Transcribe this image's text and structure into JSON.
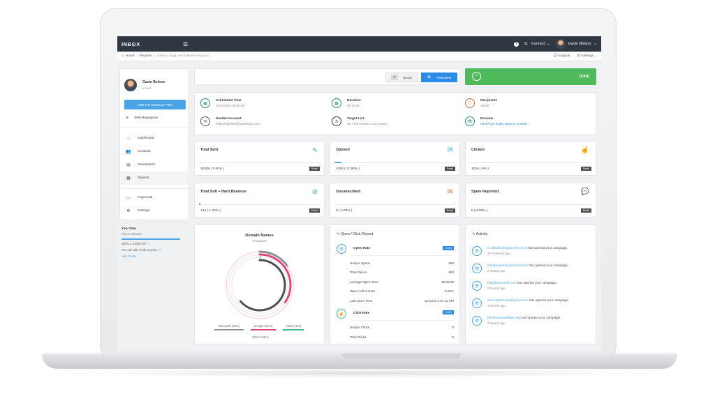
{
  "app": {
    "logo": "INB⊙X",
    "menu_icon": "hamburger-icon"
  },
  "topbar": {
    "help_icon": "question-icon",
    "connect_label": "Connect",
    "user_name": "Gavin Belson"
  },
  "breadcrumb": {
    "home": "Home",
    "reports": "Reports",
    "current": "Atalmız Saygı ve Özlemle Anıyoruz..."
  },
  "toolbar_right": {
    "support": "Support",
    "settings": "Settings"
  },
  "sidebar": {
    "user_name": "Gavin Belson",
    "location": "Hooli",
    "create_button": "CREATE NEWSLETTER",
    "reputation": "%89 Reputation",
    "items": [
      {
        "label": "Dashboard",
        "icon": "⌂"
      },
      {
        "label": "Contacts",
        "icon": "👥"
      },
      {
        "label": "Newsletters",
        "icon": "▤"
      },
      {
        "label": "Reports",
        "icon": "▦"
      },
      {
        "label": "Payments",
        "icon": "▭"
      },
      {
        "label": "Settings",
        "icon": "⚙"
      }
    ],
    "plan_title": "Your Plan",
    "plan_name": "Pay As You Go",
    "credits_left": "489711 credits left",
    "add_credit_note": "You can add credit anytime",
    "add_credit_link": "Add Credit"
  },
  "actions": {
    "back": "BACK",
    "preview": "PREVIEW",
    "done": "DONE"
  },
  "info": {
    "scheduled_label": "Scheduled Time",
    "scheduled_value": "11/10/2019 00:30:00",
    "duration_label": "Duration",
    "duration_value": "00:12:29",
    "recipients_label": "Recipients",
    "recipients_value": "10289",
    "sender_label": "Sender Account",
    "sender_value": "INBOX (destek@useinbox.com)",
    "target_label": "Target List",
    "target_value": "My First Contact List (10250)",
    "preview_label": "Preview",
    "preview_value": "Pied Piper finally slays its Goliath..."
  },
  "stats": [
    {
      "title": "Total Sent",
      "value": "10289 ( 0.00% )",
      "progress": 0
    },
    {
      "title": "Opened",
      "value": "1089 ( 17.86% )",
      "progress": 0.0586
    },
    {
      "title": "Clicked",
      "value": "1029 ( 9% )",
      "progress": 0
    },
    {
      "title": "Total Soft + Hard Bounces",
      "value": "144 ( 1.40% )",
      "progress": 0.014
    },
    {
      "title": "Unsubscribed",
      "value": "0 ( 0.00% )",
      "progress": 0
    },
    {
      "title": "Spam Reported",
      "value": "0 ( 0.00% )",
      "progress": 0
    }
  ],
  "detail_label": "Detail",
  "domains": {
    "title": "Domain Names",
    "subtitle": "Recipients",
    "legend": [
      {
        "label": "Microsoft (14%)",
        "color": "#8c9197"
      },
      {
        "label": "Google (31%)",
        "color": "#e0457b"
      },
      {
        "label": "Yahoo (1%)",
        "color": "#3fb68e"
      },
      {
        "label": "Other (54%)",
        "color": "#555"
      }
    ]
  },
  "report": {
    "title": "Open / Click Report",
    "open_rate_label": "Open Rate",
    "open_rate_badge": "5.86%",
    "rows": [
      {
        "label": "Unique Opens",
        "value": "603"
      },
      {
        "label": "Total Opens",
        "value": "853"
      },
      {
        "label": "Average Open Time",
        "value": "00:33:06"
      },
      {
        "label": "Open / Click Rate",
        "value": "0.00%"
      },
      {
        "label": "Last Open Time",
        "value": "11/13/19 1:07:22 PM"
      }
    ],
    "click_rate_label": "Click Rate",
    "click_rate_badge": "0.00%",
    "click_rows": [
      {
        "label": "Unique Clicks",
        "value": "0"
      },
      {
        "label": "Total Clicks",
        "value": "0"
      }
    ]
  },
  "activity": {
    "title": "Activity",
    "items": [
      {
        "email": "m.dikicifer@hyperroll.com.tr",
        "action": "has opened your campaign.",
        "time": "33 minute(s) ago"
      },
      {
        "email": "info@impanetworkshop.com",
        "action": "has opened your campaign.",
        "time": "2 hour(s) ago"
      },
      {
        "email": "bilgi@usemsoft.com",
        "action": "has opened your campaign.",
        "time": "3 hour(s) ago"
      },
      {
        "email": "ememplatrmarul@gmail.com",
        "action": "has opened your campaign.",
        "time": "3 hour(s) ago"
      },
      {
        "email": "info@tompanellaen.org",
        "action": "has opened your campaign.",
        "time": "3 hour(s) ago"
      }
    ]
  }
}
